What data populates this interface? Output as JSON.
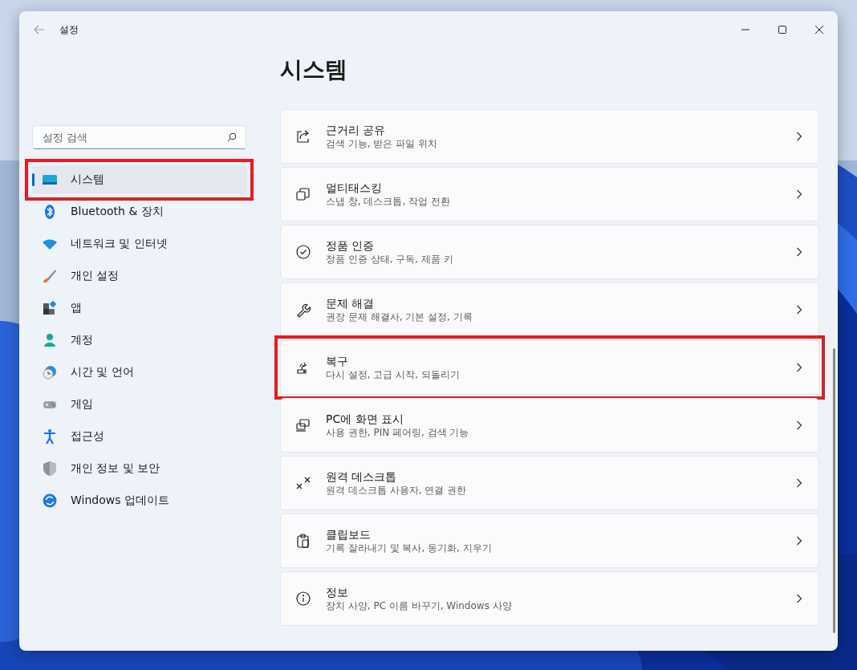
{
  "window": {
    "title": "설정"
  },
  "search": {
    "placeholder": "설정 검색"
  },
  "sidebar": {
    "items": [
      {
        "label": "시스템",
        "selected": true,
        "highlighted": true
      },
      {
        "label": "Bluetooth & 장치",
        "selected": false,
        "highlighted": false
      },
      {
        "label": "네트워크 및 인터넷",
        "selected": false,
        "highlighted": false
      },
      {
        "label": "개인 설정",
        "selected": false,
        "highlighted": false
      },
      {
        "label": "앱",
        "selected": false,
        "highlighted": false
      },
      {
        "label": "계정",
        "selected": false,
        "highlighted": false
      },
      {
        "label": "시간 및 언어",
        "selected": false,
        "highlighted": false
      },
      {
        "label": "게임",
        "selected": false,
        "highlighted": false
      },
      {
        "label": "접근성",
        "selected": false,
        "highlighted": false
      },
      {
        "label": "개인 정보 및 보안",
        "selected": false,
        "highlighted": false
      },
      {
        "label": "Windows 업데이트",
        "selected": false,
        "highlighted": false
      }
    ]
  },
  "page": {
    "title": "시스템",
    "cards": [
      {
        "title": "근거리 공유",
        "subtitle": "검색 기능, 받은 파일 위치",
        "highlighted": false
      },
      {
        "title": "멀티태스킹",
        "subtitle": "스냅 창, 데스크톱, 작업 전환",
        "highlighted": false
      },
      {
        "title": "정품 인증",
        "subtitle": "정품 인증 상태, 구독, 제품 키",
        "highlighted": false
      },
      {
        "title": "문제 해결",
        "subtitle": "권장 문제 해결사, 기본 설정, 기록",
        "highlighted": false
      },
      {
        "title": "복구",
        "subtitle": "다시 설정, 고급 시작, 되돌리기",
        "highlighted": true
      },
      {
        "title": "PC에 화면 표시",
        "subtitle": "사용 권한, PIN 페어링, 검색 기능",
        "highlighted": false
      },
      {
        "title": "원격 데스크톱",
        "subtitle": "원격 데스크톱 사용자, 연결 권한",
        "highlighted": false
      },
      {
        "title": "클립보드",
        "subtitle": "기록 잘라내기 및 복사, 동기화, 지우기",
        "highlighted": false
      },
      {
        "title": "정보",
        "subtitle": "장치 사양, PC 이름 바꾸기, Windows 사양",
        "highlighted": false
      }
    ]
  }
}
